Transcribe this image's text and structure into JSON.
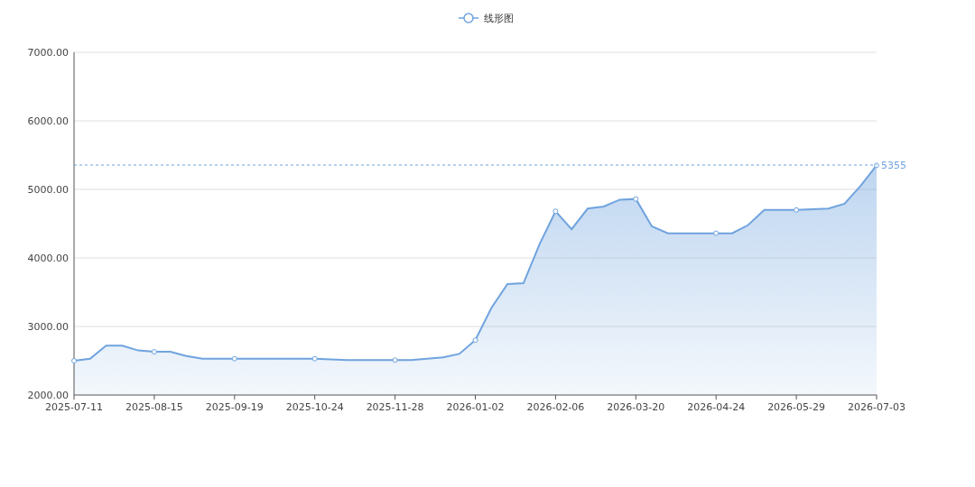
{
  "chart": {
    "chart_data": {
      "type": "area",
      "categories": [
        "2025-07-11",
        null,
        null,
        null,
        null,
        "2025-08-15",
        null,
        null,
        null,
        null,
        "2025-09-19",
        null,
        null,
        null,
        null,
        "2025-10-24",
        null,
        null,
        null,
        null,
        "2025-11-28",
        null,
        null,
        null,
        null,
        "2026-01-02",
        null,
        null,
        null,
        null,
        "2026-02-06",
        null,
        null,
        null,
        null,
        "2026-03-20",
        null,
        null,
        null,
        null,
        "2026-04-24",
        null,
        null,
        null,
        null,
        "2026-05-29",
        null,
        null,
        null,
        null,
        "2026-07-03"
      ],
      "series": [
        {
          "name": "线形图",
          "color": "#6fa3de",
          "values": [
            2500,
            2530,
            2720,
            2720,
            2650,
            2630,
            2630,
            2570,
            2530,
            2530,
            2530,
            2530,
            2530,
            2530,
            2530,
            2530,
            2520,
            2510,
            2510,
            2510,
            2510,
            2510,
            2530,
            2550,
            2600,
            2800,
            3270,
            3620,
            3630,
            4200,
            4680,
            4420,
            4720,
            4750,
            4850,
            4860,
            4460,
            4360,
            4360,
            4360,
            4360,
            4360,
            4480,
            4700,
            4700,
            4700,
            4710,
            4720,
            4790,
            5050,
            5350
          ]
        }
      ],
      "ylim": [
        2000,
        7000
      ],
      "grid": true,
      "yticks": [
        {
          "value": 2000,
          "label": "2000.00"
        },
        {
          "value": 3000,
          "label": "3000.00"
        },
        {
          "value": 4000,
          "label": "4000.00"
        },
        {
          "value": 5000,
          "label": "5000.00"
        },
        {
          "value": 6000,
          "label": "6000.00"
        },
        {
          "value": 7000,
          "label": "7000.00"
        }
      ],
      "ref_lines": [
        {
          "axis": "y",
          "value": 5355,
          "label": "5355",
          "color": "#6fa3de"
        }
      ]
    }
  }
}
